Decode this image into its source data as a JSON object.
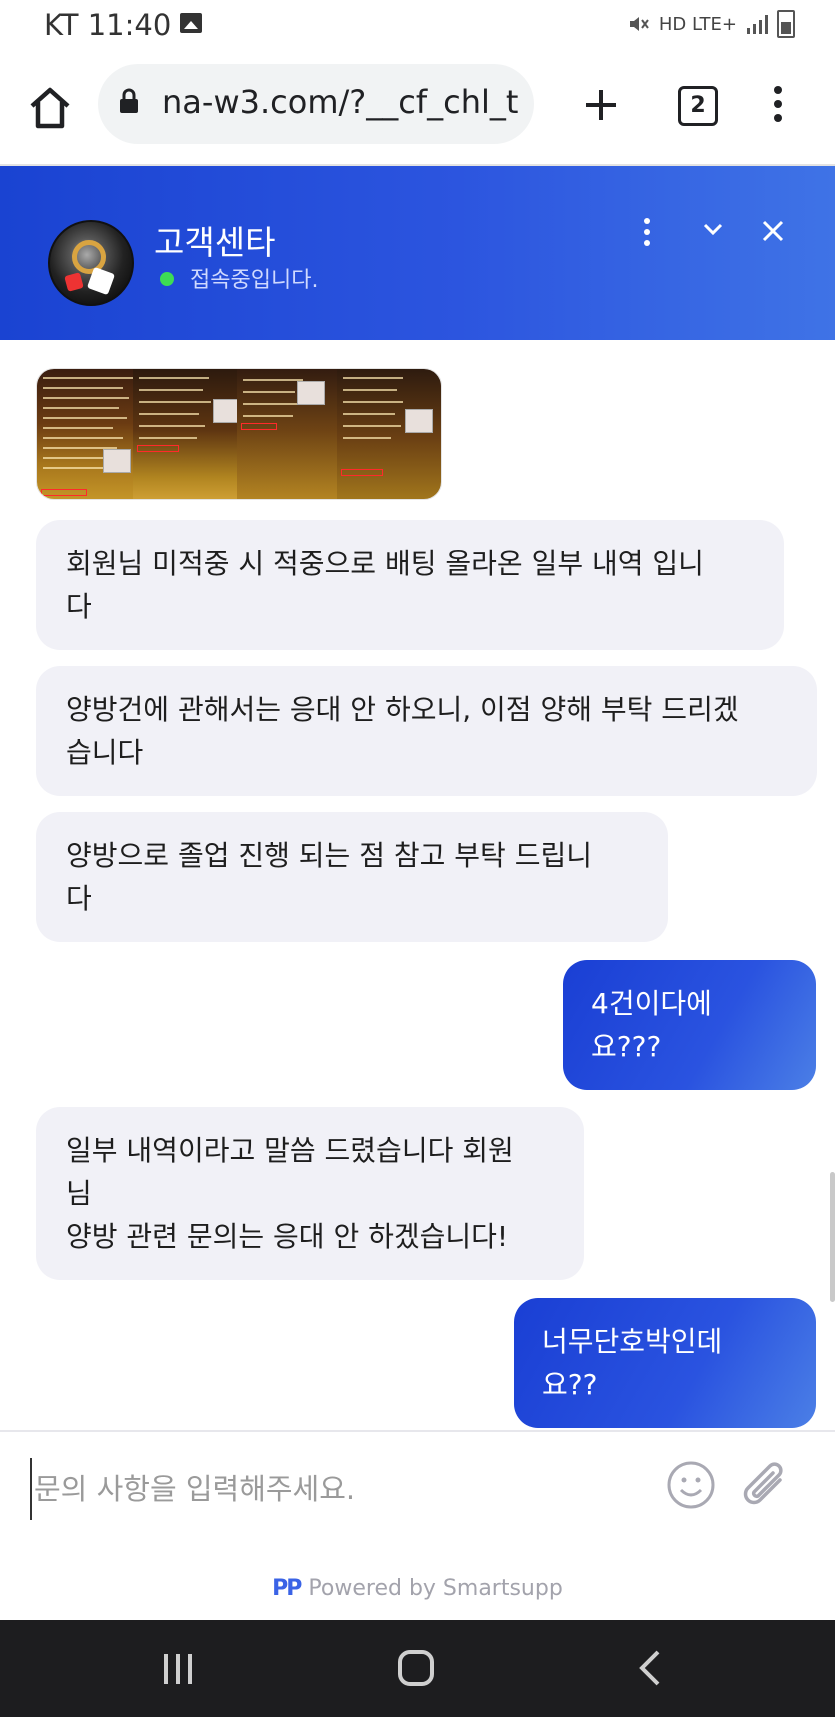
{
  "status_bar": {
    "carrier_time": "KT 11:40",
    "indicators": "HD LTE+"
  },
  "browser": {
    "url": "na-w3.com/?__cf_chl_t",
    "tab_count": "2"
  },
  "chat_header": {
    "title": "고객센타",
    "status": "접속중입니다.",
    "online_color": "#3ddc55"
  },
  "messages": [
    {
      "type": "image",
      "direction": "in"
    },
    {
      "type": "text",
      "direction": "in",
      "lines": [
        "회원님 미적중 시 적중으로 배팅 올라온 일부 내역 입니",
        "다"
      ]
    },
    {
      "type": "text",
      "direction": "in",
      "lines": [
        "양방건에 관해서는 응대 안 하오니, 이점 양해 부탁 드리겠",
        "습니다"
      ]
    },
    {
      "type": "text",
      "direction": "in",
      "lines": [
        "양방으로 졸업 진행 되는 점 참고 부탁 드립니",
        "다"
      ]
    },
    {
      "type": "text",
      "direction": "out",
      "lines": [
        "4건이다에",
        "요???"
      ]
    },
    {
      "type": "text",
      "direction": "in",
      "lines": [
        "일부 내역이라고 말씀 드렸습니다 회원",
        "님",
        "양방 관련 문의는 응대 안 하겠습니다!"
      ]
    },
    {
      "type": "text",
      "direction": "out",
      "lines": [
        "너무단호박인데",
        "요??"
      ]
    }
  ],
  "input": {
    "placeholder": "문의 사항을 입력해주세요."
  },
  "footer": {
    "powered_by": "Powered by Smartsupp",
    "logo": "PP"
  },
  "colors": {
    "header_gradient_start": "#1a43d2",
    "header_gradient_end": "#3f73e6",
    "incoming_bubble": "#f1f1f7",
    "outgoing_bubble": "#2a53e0"
  }
}
